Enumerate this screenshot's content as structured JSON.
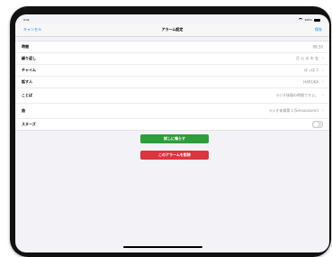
{
  "status": {
    "time": "9:41",
    "battery": "100%"
  },
  "nav": {
    "cancel": "キャンセル",
    "title": "アラーム設定",
    "save": "保存"
  },
  "rows": [
    {
      "label": "時間",
      "value": "08:30"
    },
    {
      "label": "繰り返し",
      "value": "月 火 水 木 金"
    },
    {
      "label": "チャイム",
      "value": "ぱっぱ 1"
    },
    {
      "label": "話す人",
      "value": "HARUKA"
    },
    {
      "label": "ことば",
      "value": "ラジオ体操の時間ですよ。"
    },
    {
      "label": "曲",
      "value": "ラジオ体操第１(Senaoozumi)"
    },
    {
      "label": "スヌーズ",
      "toggle_on": false
    }
  ],
  "buttons": {
    "test": "試しに鳴らす",
    "delete": "このアラームを削除"
  },
  "colors": {
    "accent": "#007aff",
    "test_button": "#2e9e3a",
    "delete_button": "#d9363e"
  }
}
